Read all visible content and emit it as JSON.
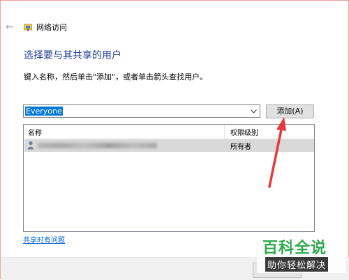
{
  "window": {
    "title": "网络访问"
  },
  "dialog": {
    "heading": "选择要与其共享的用户",
    "instruction": "键入名称，然后单击\"添加\"，或者单击箭头查找用户。"
  },
  "user_combo": {
    "value": "Everyone"
  },
  "add_button": {
    "label": "添加(A)"
  },
  "table": {
    "columns": [
      "名称",
      "权限级别"
    ],
    "rows": [
      {
        "name_redacted": true,
        "permission": "所有者"
      }
    ]
  },
  "help_link": {
    "label": "共享时有问题"
  },
  "watermark": {
    "title": "百科全说",
    "subtitle": "助你轻松解决"
  },
  "colors": {
    "heading": "#1e3c96",
    "selection": "#0078d7",
    "link": "#0066cc",
    "annotation_arrow": "#e8383d",
    "watermark_green": "#2fa84f"
  },
  "icons": {
    "back": "back-arrow-icon",
    "network": "network-folder-icon",
    "user": "user-icon",
    "dropdown": "chevron-down-icon"
  }
}
